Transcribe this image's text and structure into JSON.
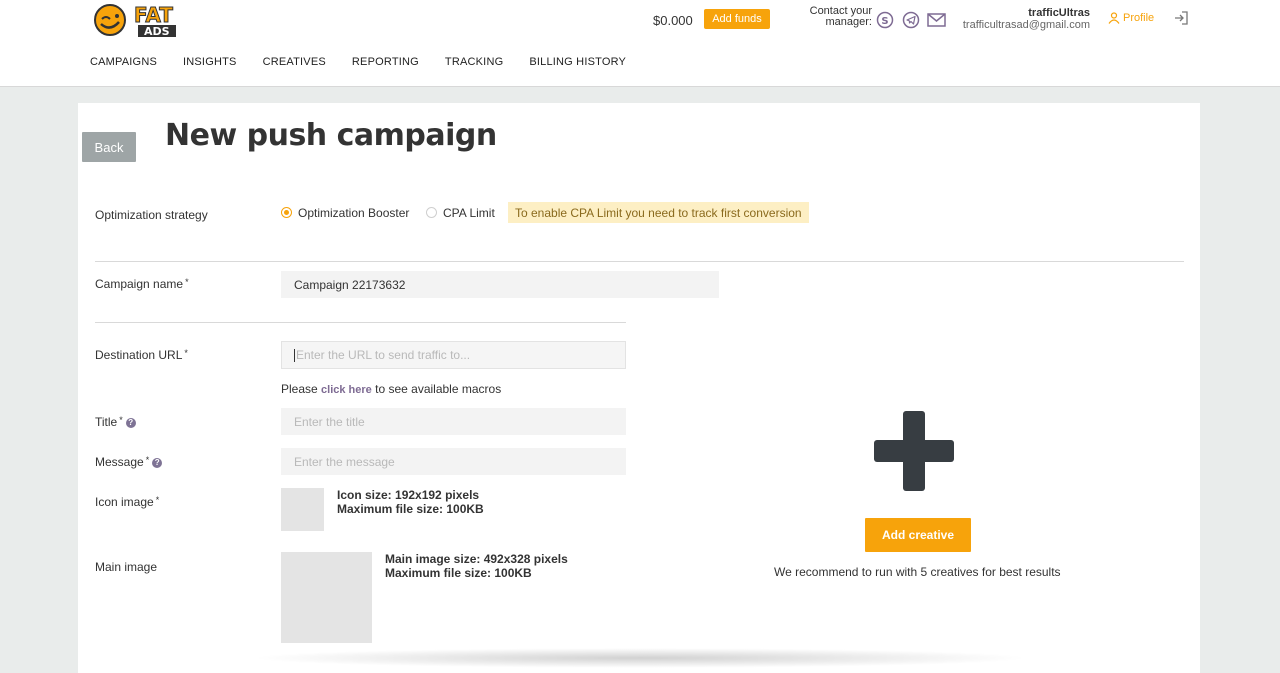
{
  "header": {
    "logo_text": "FAT ADS",
    "balance": "$0.000",
    "add_funds_label": "Add funds",
    "contact_label_line1": "Contact your",
    "contact_label_line2": "manager:",
    "manager_icons": [
      "skype-icon",
      "telegram-icon",
      "mail-icon"
    ],
    "user_name": "trafficUltras",
    "user_email": "trafficultrasad@gmail.com",
    "profile_label": "Profile"
  },
  "nav": {
    "items": [
      "CAMPAIGNS",
      "INSIGHTS",
      "CREATIVES",
      "REPORTING",
      "TRACKING",
      "BILLING HISTORY"
    ]
  },
  "page": {
    "back_label": "Back",
    "title": "New push campaign"
  },
  "form": {
    "optimization_label": "Optimization strategy",
    "opt_booster": "Optimization Booster",
    "opt_cpa": "CPA Limit",
    "cpa_notice": "To enable CPA Limit you need to track first conversion",
    "campaign_name_label": "Campaign name",
    "campaign_name_value": "Campaign 22173632",
    "dest_url_label": "Destination URL",
    "dest_url_placeholder": "Enter the URL to send traffic to...",
    "macro_prefix": "Please ",
    "macro_link": "click here",
    "macro_suffix": " to see available macros",
    "title_label": "Title",
    "title_placeholder": "Enter the title",
    "message_label": "Message",
    "message_placeholder": "Enter the message",
    "icon_label": "Icon image",
    "icon_size": "Icon size: 192x192 pixels",
    "icon_max": "Maximum file size: 100KB",
    "main_label": "Main image",
    "main_size": "Main image size: 492x328 pixels",
    "main_max": "Maximum file size: 100KB",
    "required_mark": "*",
    "help_mark": "?"
  },
  "creative": {
    "add_label": "Add creative",
    "recommend_text": "We recommend to run with 5 creatives for best results"
  },
  "colors": {
    "accent": "#f7a30b",
    "back_button": "#9ea5a6",
    "notice_bg": "#fdefc4",
    "link": "#7e6b93"
  }
}
